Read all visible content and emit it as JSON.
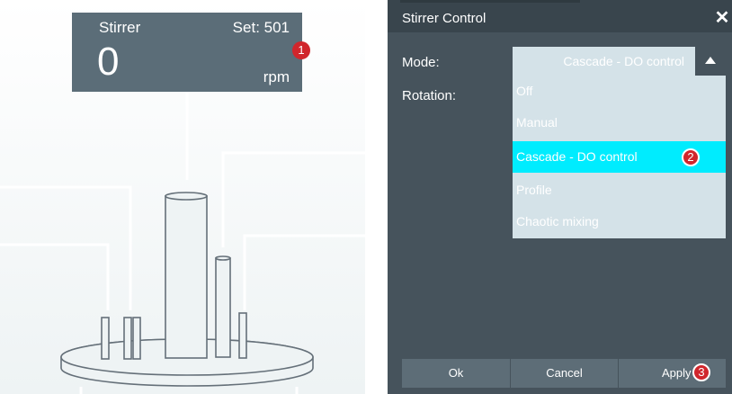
{
  "stirrer_readout": {
    "name": "Stirrer",
    "setpoint": "Set: 501",
    "value": "0",
    "unit": "rpm"
  },
  "markers": [
    "1",
    "2",
    "3"
  ],
  "dialog": {
    "title": "Stirrer Control",
    "close_symbol": "✕",
    "mode_label": "Mode:",
    "rotation_label": "Rotation:",
    "mode_selected": "Cascade - DO control",
    "mode_options": [
      "Off",
      "Manual",
      "Cascade - DO control",
      "Profile",
      "Chaotic mixing"
    ],
    "highlighted_option": "Cascade - DO control",
    "buttons": {
      "ok": "Ok",
      "cancel": "Cancel",
      "apply": "Apply"
    }
  },
  "colors": {
    "readout_bg": "#5b6d78",
    "dialog_bg": "#46535c",
    "dropdown_bg": "#d4e2e8",
    "highlight": "#00ecfe",
    "marker": "#d0262c"
  },
  "icons": {
    "dropdown_arrow": "triangle-up-icon",
    "close": "close-icon"
  }
}
